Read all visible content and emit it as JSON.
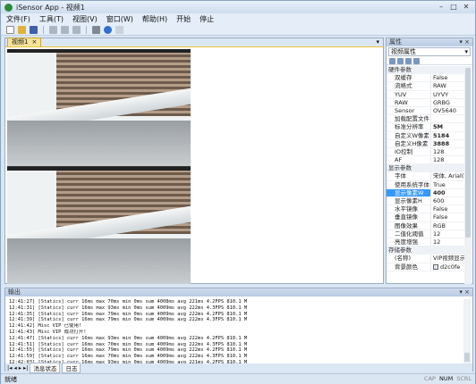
{
  "window": {
    "title": "iSensor App - 视频1",
    "min": "–",
    "max": "□",
    "close": "✕"
  },
  "menu": [
    "文件(F)",
    "工具(T)",
    "视图(V)",
    "窗口(W)",
    "帮助(H)",
    "开始",
    "停止"
  ],
  "doc_tab": {
    "label": "视频1",
    "close": "×"
  },
  "props_panel": {
    "title": "属性",
    "pin": "▾ ×",
    "selector": "视频属性",
    "categories": [
      {
        "name": "硬件参数",
        "rows": [
          {
            "k": "双缓存",
            "v": "False"
          },
          {
            "k": "流格式",
            "v": "RAW"
          },
          {
            "k": "YUV",
            "v": "UYVY"
          },
          {
            "k": "RAW",
            "v": "GRBG"
          },
          {
            "k": "Sensor",
            "v": "OV5640"
          },
          {
            "k": "加载配置文件",
            "v": ""
          },
          {
            "k": "标准分辨率",
            "v": "5M",
            "bold": true
          },
          {
            "k": "自定义W像素",
            "v": "5184",
            "bold": true
          },
          {
            "k": "自定义H像素",
            "v": "3888",
            "bold": true
          },
          {
            "k": "IO控制",
            "v": "128"
          },
          {
            "k": "AF",
            "v": "128"
          }
        ]
      },
      {
        "name": "显示参数",
        "rows": [
          {
            "k": "字体",
            "v": "宋体, Arial(9)"
          },
          {
            "k": "使用系统字体",
            "v": "True"
          },
          {
            "k": "显示像素W",
            "v": "400",
            "bold": true,
            "selected": true
          },
          {
            "k": "显示像素H",
            "v": "600"
          },
          {
            "k": "水平镜像",
            "v": "False"
          },
          {
            "k": "垂直镜像",
            "v": "False"
          },
          {
            "k": "图像效果",
            "v": "RGB"
          },
          {
            "k": "二值化阈值",
            "v": "12"
          },
          {
            "k": "亮度增强",
            "v": "12"
          }
        ]
      },
      {
        "name": "存储参数",
        "rows": [
          {
            "k": "(名称)",
            "v": "VIP视频显示..."
          },
          {
            "k": "背景颜色",
            "v": "d2c0fe",
            "swatch": "#dfe3ff"
          }
        ]
      }
    ]
  },
  "output": {
    "title": "输出",
    "lines": [
      "12:41:27] [Statics] curr 16ms max 70ms min 0ms sum 4008ms avg 221ms 4.2FPS 810.1 M",
      "12:41:31] [Statics] curr 16ms max 93ms min 0ms sum 4009ms avg 222ms 4.3FPS 810.1 M",
      "12:41:35] [Statics] curr 16ms max 79ms min 0ms sum 4009ms avg 222ms 4.2FPS 810.1 M",
      "12:41:39] [Statics] curr 16ms max 79ms min 0ms sum 4009ms avg 222ms 4.3FPS 810.1 M",
      "12:41:42] Misc VIP 已使用!",
      "12:41:43] Misc VIP 成功打开!",
      "12:41:47] [Statics] curr 16ms max 93ms min 0ms sum 4009ms avg 222ms 4.2FPS 810.1 M",
      "12:41:51] [Statics] curr 16ms max 70ms min 0ms sum 4009ms avg 222ms 4.3FPS 810.1 M",
      "12:41:55] [Statics] curr 16ms max 79ms min 0ms sum 4009ms avg 222ms 4.2FPS 810.1 M",
      "12:41:59] [Statics] curr 16ms max 70ms min 0ms sum 4009ms avg 222ms 4.3FPS 810.1 M",
      "12:42:03] [Statics] curr 16ms max 93ms min 0ms sum 4009ms avg 221ms 4.2FPS 810.1 M",
      "12:42:07] [Statics] curr 16ms max 70ms min 0ms sum 4009ms avg 221ms 4.3FPS 810.1 M"
    ],
    "tabs": [
      "消息状态",
      "日志"
    ]
  },
  "status": {
    "left": "就绪",
    "caps": "CAP",
    "num": "NUM",
    "scrl": "SCRL"
  }
}
